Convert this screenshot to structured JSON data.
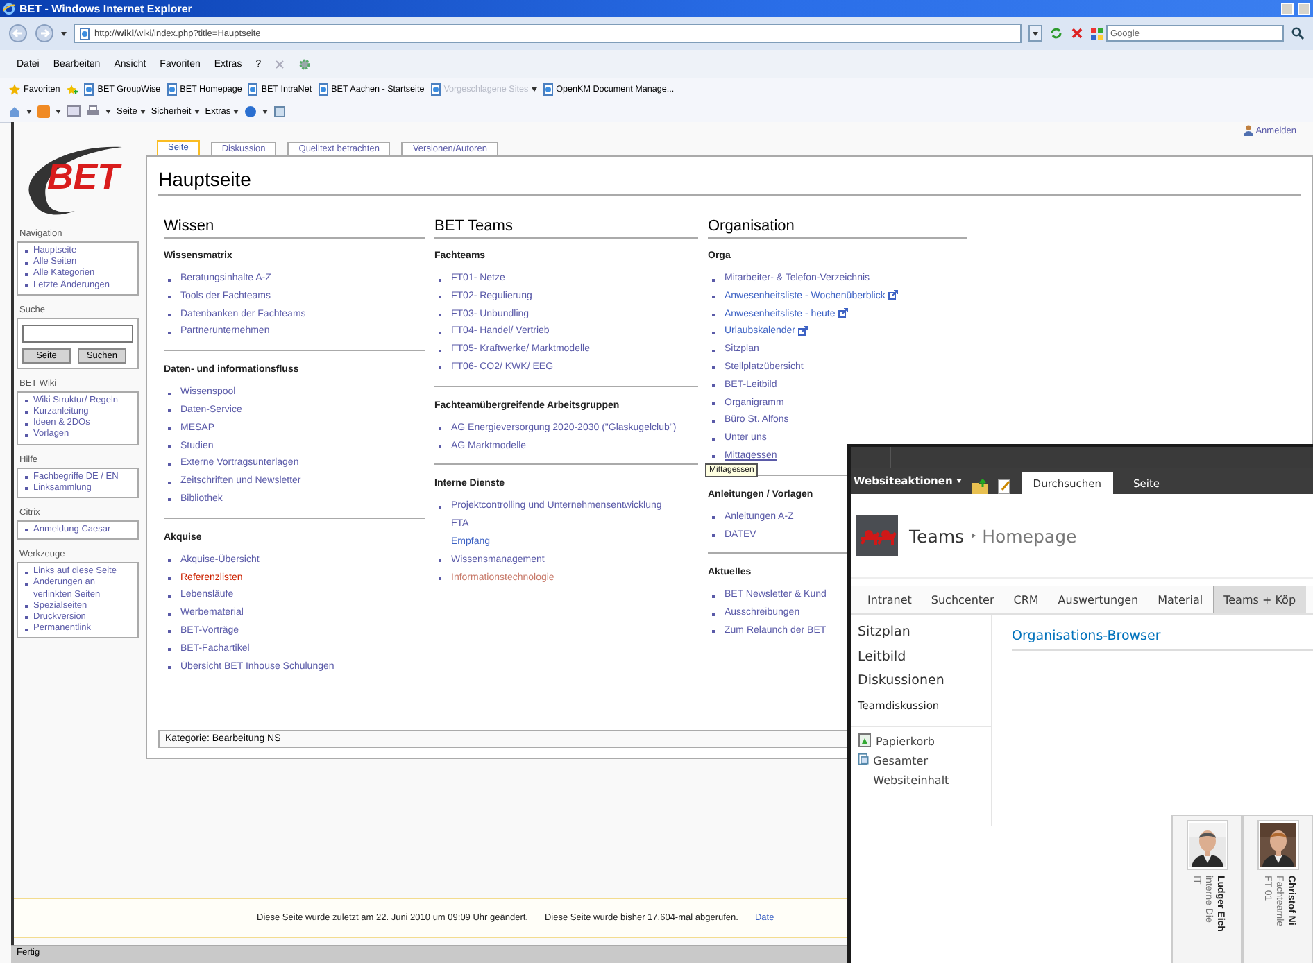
{
  "window": {
    "title": "BET - Windows Internet Explorer",
    "address": "http://**wiki**/wiki/index.php?title=Hauptseite"
  },
  "search": {
    "placeholder": "Google"
  },
  "menu": [
    "Datei",
    "Bearbeiten",
    "Ansicht",
    "Favoriten",
    "Extras",
    "?"
  ],
  "favorites_bar": {
    "label": "Favoriten",
    "items": [
      {
        "label": "BET GroupWise",
        "disabled": false
      },
      {
        "label": "BET Homepage",
        "disabled": false
      },
      {
        "label": "BET IntraNet",
        "disabled": false
      },
      {
        "label": "BET Aachen - Startseite",
        "disabled": false
      },
      {
        "label": "Vorgeschlagene Sites",
        "disabled": true
      },
      {
        "label": "OpenKM Document Manage...",
        "disabled": false
      }
    ]
  },
  "command_bar": [
    "Seite",
    "Sicherheit",
    "Extras"
  ],
  "user_link": "Anmelden",
  "wiki": {
    "logo": "BET",
    "sidebar": [
      {
        "kind": "links",
        "title": "Navigation",
        "items": [
          "Hauptseite",
          "Alle Seiten",
          "Alle Kategorien",
          "Letzte Änderungen"
        ]
      },
      {
        "kind": "search",
        "title": "Suche",
        "buttons": [
          "Seite",
          "Suchen"
        ]
      },
      {
        "kind": "links",
        "title": "BET Wiki",
        "items": [
          "Wiki Struktur/ Regeln",
          "Kurzanleitung",
          "Ideen & 2DOs",
          "Vorlagen"
        ]
      },
      {
        "kind": "links",
        "title": "Hilfe",
        "items": [
          "Fachbegriffe DE / EN",
          "Linksammlung"
        ]
      },
      {
        "kind": "links",
        "title": "Citrix",
        "items": [
          "Anmeldung Caesar"
        ]
      },
      {
        "kind": "links",
        "title": "Werkzeuge",
        "items": [
          "Links auf diese Seite",
          "Änderungen an verlinkten Seiten",
          "Spezialseiten",
          "Druckversion",
          "Permanentlink"
        ]
      }
    ],
    "tabs": [
      {
        "label": "Seite",
        "selected": true
      },
      {
        "label": "Diskussion",
        "selected": false
      },
      {
        "label": "Quelltext betrachten",
        "selected": false
      },
      {
        "label": "Versionen/Autoren",
        "selected": false
      }
    ],
    "title": "Hauptseite",
    "columns": [
      {
        "heading": "Wissen",
        "groups": [
          {
            "title": "Wissensmatrix",
            "items": [
              {
                "label": "Beratungsinhalte A-Z",
                "kind": "link"
              },
              {
                "label": "Tools der Fachteams",
                "kind": "link"
              },
              {
                "label": "Datenbanken der Fachteams",
                "kind": "link"
              },
              {
                "label": "Partnerunternehmen",
                "kind": "link"
              }
            ]
          },
          {
            "title": "Daten- und informationsfluss",
            "items": [
              {
                "label": "Wissenspool",
                "kind": "link"
              },
              {
                "label": "Daten-Service",
                "kind": "link"
              },
              {
                "label": "MESAP",
                "kind": "link"
              },
              {
                "label": "Studien",
                "kind": "link"
              },
              {
                "label": "Externe Vortragsunterlagen",
                "kind": "link"
              },
              {
                "label": "Zeitschriften und Newsletter",
                "kind": "link"
              },
              {
                "label": "Bibliothek",
                "kind": "link"
              }
            ]
          },
          {
            "title": "Akquise",
            "items": [
              {
                "label": "Akquise-Übersicht",
                "kind": "link"
              },
              {
                "label": "Referenzlisten",
                "kind": "new"
              },
              {
                "label": "Lebensläufe",
                "kind": "link"
              },
              {
                "label": "Werbematerial",
                "kind": "link"
              },
              {
                "label": "BET-Vorträge",
                "kind": "link"
              },
              {
                "label": "BET-Fachartikel",
                "kind": "link"
              },
              {
                "label": "Übersicht BET Inhouse Schulungen",
                "kind": "link"
              }
            ]
          }
        ]
      },
      {
        "heading": "BET Teams",
        "groups": [
          {
            "title": "Fachteams",
            "items": [
              {
                "label": "FT01- Netze",
                "kind": "link"
              },
              {
                "label": "FT02- Regulierung",
                "kind": "link"
              },
              {
                "label": "FT03- Unbundling",
                "kind": "link"
              },
              {
                "label": "FT04- Handel/ Vertrieb",
                "kind": "link"
              },
              {
                "label": "FT05- Kraftwerke/ Marktmodelle",
                "kind": "link"
              },
              {
                "label": "FT06- CO2/ KWK/ EEG",
                "kind": "link"
              }
            ]
          },
          {
            "title": "Fachteamübergreifende Arbeitsgruppen",
            "items": [
              {
                "label": "AG Energieversorgung 2020-2030 (\"Glaskugelclub\")",
                "kind": "link"
              },
              {
                "label": "AG Marktmodelle",
                "kind": "link"
              }
            ]
          },
          {
            "title": "Interne Dienste",
            "items": [
              {
                "label": "Projektcontrolling und Unternehmensentwicklung",
                "kind": "link",
                "sub": [
                  "FTA",
                  "Empfang"
                ]
              },
              {
                "label": "Wissensmanagement",
                "kind": "link"
              },
              {
                "label": "Informationstechnologie",
                "kind": "new-visited"
              }
            ]
          }
        ]
      },
      {
        "heading": "Organisation",
        "groups": [
          {
            "title": "Orga",
            "items": [
              {
                "label": "Mitarbeiter- & Telefon-Verzeichnis",
                "kind": "link"
              },
              {
                "label": "Anwesenheitsliste - Wochenüberblick",
                "kind": "external"
              },
              {
                "label": "Anwesenheitsliste - heute",
                "kind": "external"
              },
              {
                "label": "Urlaubskalender",
                "kind": "external"
              },
              {
                "label": "Sitzplan",
                "kind": "link"
              },
              {
                "label": "Stellplatzübersicht",
                "kind": "link"
              },
              {
                "label": "BET-Leitbild",
                "kind": "link"
              },
              {
                "label": "Organigramm",
                "kind": "link"
              },
              {
                "label": "Büro St. Alfons",
                "kind": "link"
              },
              {
                "label": "Unter uns",
                "kind": "link"
              },
              {
                "label": "Mittagessen",
                "kind": "hover",
                "tooltip": "Mittagessen"
              }
            ]
          },
          {
            "title": "Anleitungen / Vorlagen",
            "items": [
              {
                "label": "Anleitungen A-Z",
                "kind": "link"
              },
              {
                "label": "DATEV",
                "kind": "link"
              }
            ]
          },
          {
            "title": "Aktuelles",
            "items": [
              {
                "label": "BET Newsletter & Kund",
                "kind": "link"
              },
              {
                "label": "Ausschreibungen",
                "kind": "link"
              },
              {
                "label": "Zum Relaunch der BET",
                "kind": "link"
              }
            ]
          }
        ]
      }
    ],
    "category": "Kategorie: Bearbeitung NS"
  },
  "footer": [
    "Diese Seite wurde zuletzt am 22. Juni 2010 um 09:09 Uhr geändert.",
    "Diese Seite wurde bisher 17.604-mal abgerufen.",
    "Date"
  ],
  "status_bar": "Fertig",
  "sharepoint": {
    "site_actions": "Websiteaktionen",
    "ribbon_tabs": [
      {
        "label": "Durchsuchen",
        "selected": true
      },
      {
        "label": "Seite",
        "selected": false
      }
    ],
    "breadcrumb": [
      "Teams",
      "Homepage"
    ],
    "nav": [
      {
        "label": "Intranet",
        "selected": false
      },
      {
        "label": "Suchcenter",
        "selected": false
      },
      {
        "label": "CRM",
        "selected": false
      },
      {
        "label": "Auswertungen",
        "selected": false
      },
      {
        "label": "Material",
        "selected": false
      },
      {
        "label": "Teams + Köp",
        "selected": true
      }
    ],
    "quicklaunch": [
      {
        "label": "Sitzplan",
        "kind": "heading"
      },
      {
        "label": "Leitbild",
        "kind": "heading"
      },
      {
        "label": "Diskussionen",
        "kind": "heading"
      },
      {
        "label": "Teamdiskussion",
        "kind": "sub"
      }
    ],
    "tools": [
      {
        "label": "Papierkorb",
        "kind": "recycle"
      },
      {
        "label": "Gesamter Websiteinhalt",
        "kind": "content"
      }
    ],
    "webpart_title": "Organisations-Browser",
    "people": [
      {
        "name": "Ludger Eich",
        "role": "interne Die",
        "team": "IT"
      },
      {
        "name": "Christof Ni",
        "role": "Fachteamle",
        "team": "FT 01"
      }
    ]
  }
}
